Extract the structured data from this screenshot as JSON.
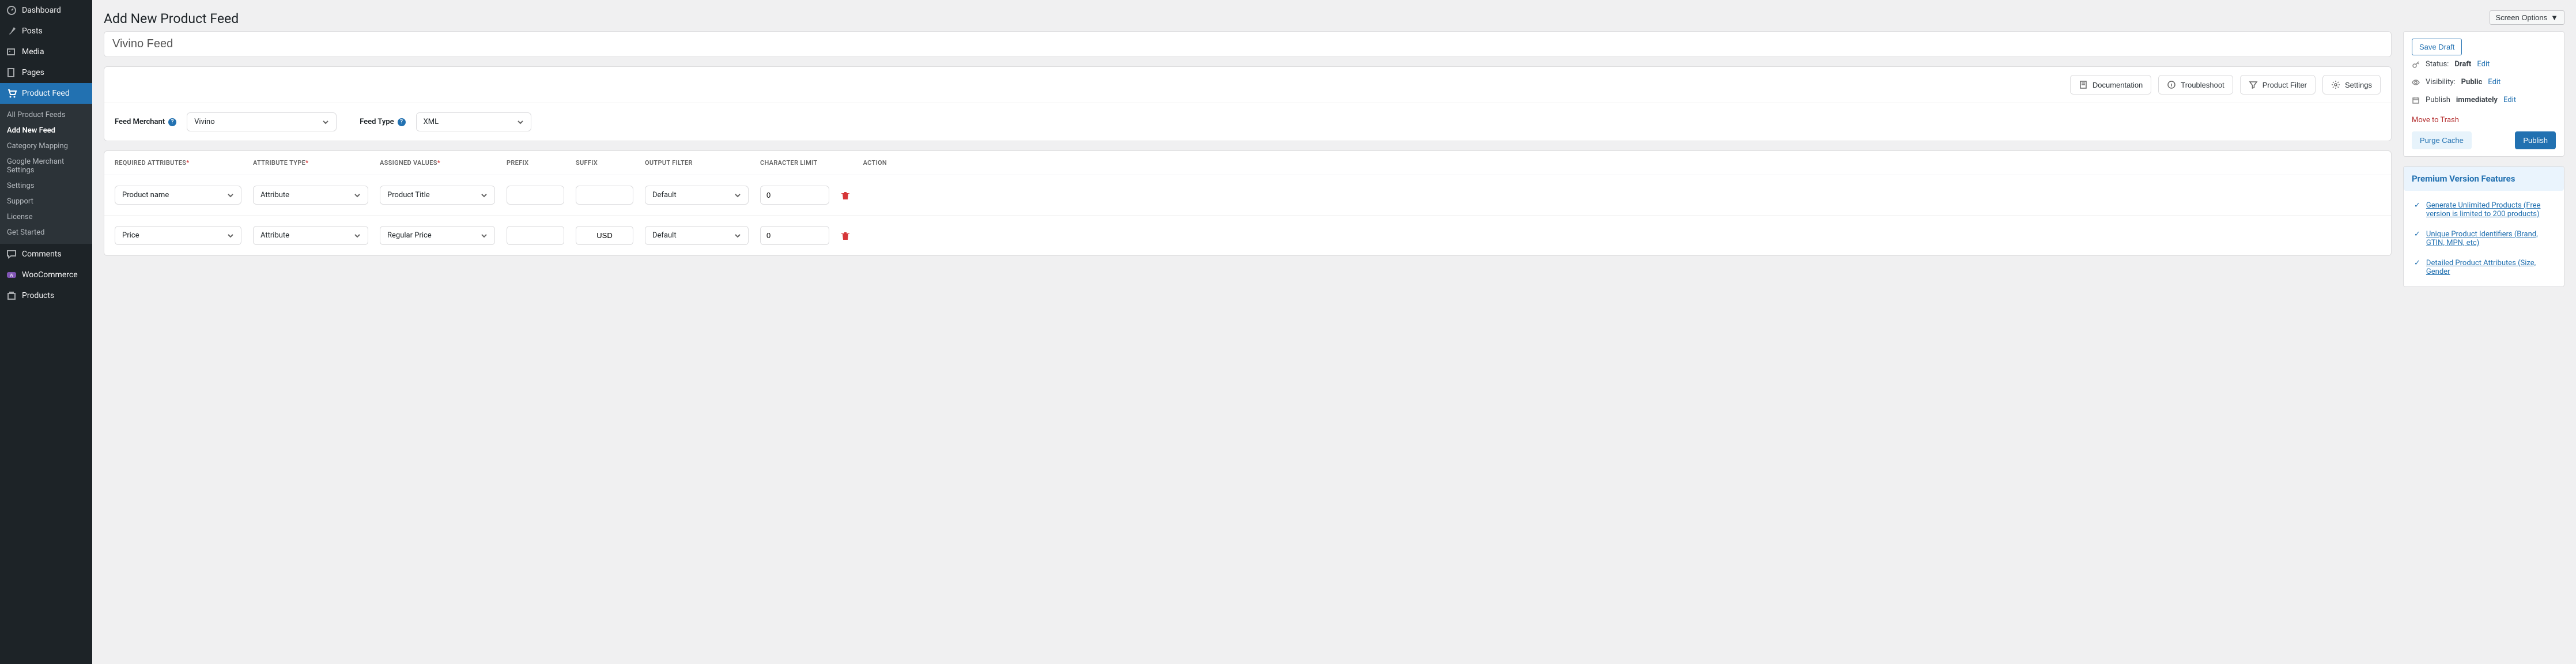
{
  "header": {
    "page_title": "Add New Product Feed",
    "screen_options": "Screen Options"
  },
  "sidebar": {
    "items": [
      {
        "label": "Dashboard"
      },
      {
        "label": "Posts"
      },
      {
        "label": "Media"
      },
      {
        "label": "Pages"
      },
      {
        "label": "Product Feed"
      },
      {
        "label": "Comments"
      },
      {
        "label": "WooCommerce"
      },
      {
        "label": "Products"
      }
    ],
    "submenu": [
      {
        "label": "All Product Feeds"
      },
      {
        "label": "Add New Feed"
      },
      {
        "label": "Category Mapping"
      },
      {
        "label": "Google Merchant Settings"
      },
      {
        "label": "Settings"
      },
      {
        "label": "Support"
      },
      {
        "label": "License"
      },
      {
        "label": "Get Started"
      }
    ]
  },
  "feed": {
    "title": "Vivino Feed",
    "merchant_label": "Feed Merchant",
    "merchant_value": "Vivino",
    "type_label": "Feed Type",
    "type_value": "XML"
  },
  "toolbar": {
    "documentation": "Documentation",
    "troubleshoot": "Troubleshoot",
    "product_filter": "Product Filter",
    "settings": "Settings"
  },
  "table": {
    "headers": {
      "required": "Required Attributes",
      "type": "Attribute Type",
      "assigned": "Assigned Values",
      "prefix": "Prefix",
      "suffix": "Suffix",
      "output": "Output Filter",
      "limit": "Character Limit",
      "action": "Action"
    },
    "rows": [
      {
        "attr": "Product name",
        "type": "Attribute",
        "assigned": "Product Title",
        "prefix": "",
        "suffix": "",
        "output": "Default",
        "limit": "0"
      },
      {
        "attr": "Price",
        "type": "Attribute",
        "assigned": "Regular Price",
        "prefix": "",
        "suffix": "USD",
        "output": "Default",
        "limit": "0"
      }
    ]
  },
  "publish": {
    "save_draft": "Save Draft",
    "status_label": "Status:",
    "status_value": "Draft",
    "visibility_label": "Visibility:",
    "visibility_value": "Public",
    "publish_label": "Publish",
    "publish_value": "immediately",
    "edit": "Edit",
    "move_trash": "Move to Trash",
    "purge_cache": "Purge Cache",
    "publish_btn": "Publish"
  },
  "promo": {
    "heading": "Premium Version Features",
    "items": [
      "Generate Unlimited Products (Free version is limited to 200 products)",
      "Unique Product Identifiers (Brand, GTIN, MPN, etc)",
      "Detailed Product Attributes (Size, Gender"
    ]
  }
}
